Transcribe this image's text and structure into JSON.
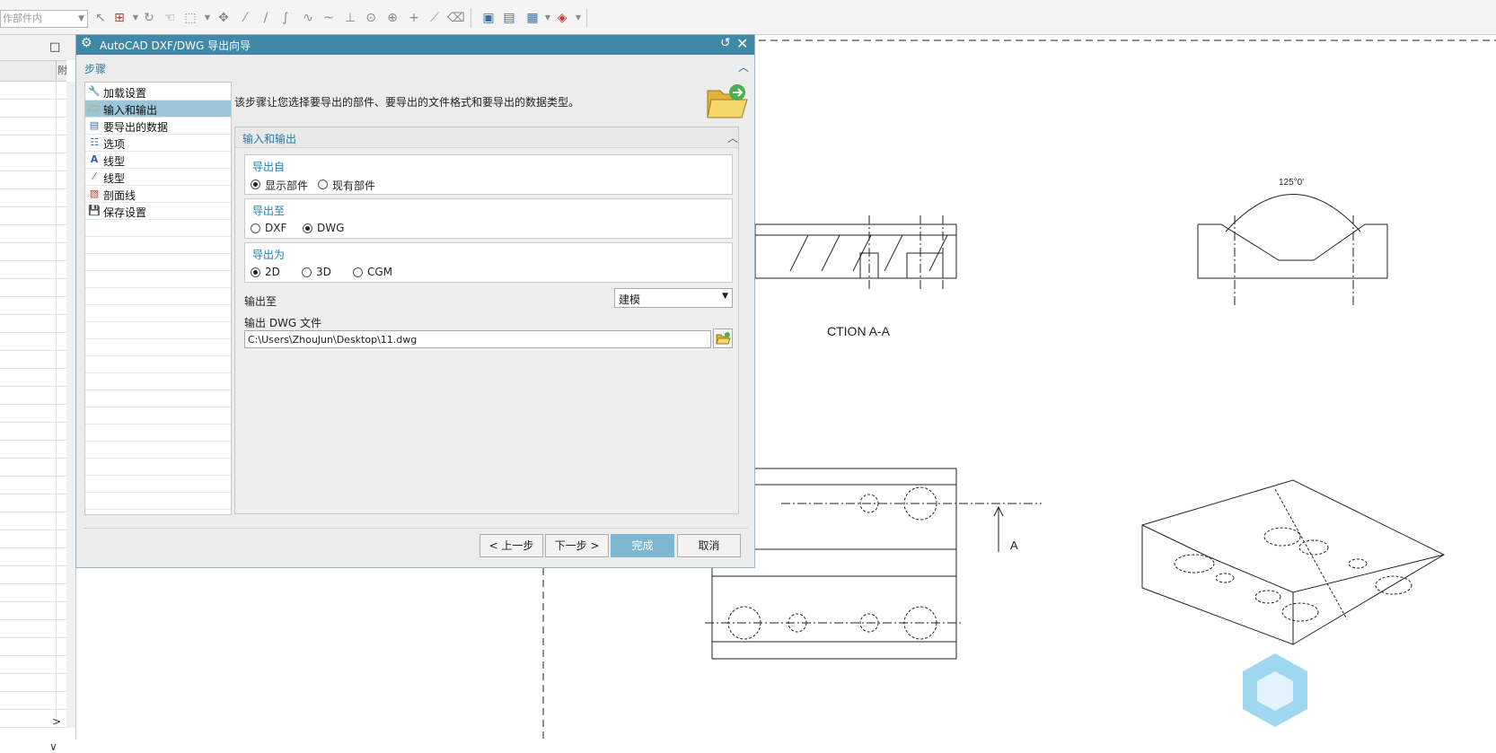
{
  "toolbar": {
    "filter_value": "作部件内",
    "icons": [
      "snap-point-icon",
      "snap-options-icon",
      "rotate-icon",
      "quick-pick-icon",
      "box-select-icon",
      "move-icon",
      "line-icon",
      "line-2-icon",
      "arc-icon",
      "spline-icon",
      "curve-icon",
      "point-icon",
      "circle-icon",
      "center-icon",
      "cross-icon",
      "slash-icon",
      "eraser-icon",
      "view-fit-icon",
      "view-section-icon",
      "layer-icon",
      "display-icon"
    ]
  },
  "navigator": {
    "column_label": "附",
    "maximize_glyph": "□",
    "scroll_right_glyph": ">",
    "collapse_glyph": "∨"
  },
  "drawing": {
    "section_label": "CTION A-A",
    "angle_label": "125°0'",
    "view_label": "A"
  },
  "dialog": {
    "title": "AutoCAD DXF/DWG 导出向导",
    "steps_header": "步骤",
    "steps": [
      {
        "label": "加载设置",
        "icon": "wrench-icon",
        "selected": false
      },
      {
        "label": "输入和输出",
        "icon": "folder-icon",
        "selected": true
      },
      {
        "label": "要导出的数据",
        "icon": "data-icon",
        "selected": false
      },
      {
        "label": "选项",
        "icon": "options-icon",
        "selected": false
      },
      {
        "label": "线型",
        "icon": "linetype-icon",
        "selected": false
      },
      {
        "label": "线型",
        "icon": "line-icon",
        "selected": false
      },
      {
        "label": "剖面线",
        "icon": "hatch-icon",
        "selected": false
      },
      {
        "label": "保存设置",
        "icon": "save-icon",
        "selected": false
      }
    ],
    "intro": "该步骤让您选择要导出的部件、要导出的文件格式和要导出的数据类型。",
    "section_title": "输入和输出",
    "export_from": {
      "label": "导出自",
      "options": [
        "显示部件",
        "现有部件"
      ],
      "selected": "显示部件"
    },
    "export_to": {
      "label": "导出至",
      "options": [
        "DXF",
        "DWG"
      ],
      "selected": "DWG"
    },
    "export_as": {
      "label": "导出为",
      "options": [
        "2D",
        "3D",
        "CGM"
      ],
      "selected": "2D"
    },
    "output_to": {
      "label": "输出至",
      "value": "建模"
    },
    "output_file": {
      "label": "输出 DWG 文件",
      "value": "C:\\Users\\ZhouJun\\Desktop\\11.dwg"
    },
    "buttons": {
      "back": "< 上一步",
      "next": "下一步 >",
      "finish": "完成",
      "cancel": "取消"
    },
    "colors": {
      "title_bar": "#3f88a8",
      "accent_text": "#1d7eab",
      "selected_step": "#9cc6d8",
      "finish_button": "#7db7d0"
    }
  }
}
